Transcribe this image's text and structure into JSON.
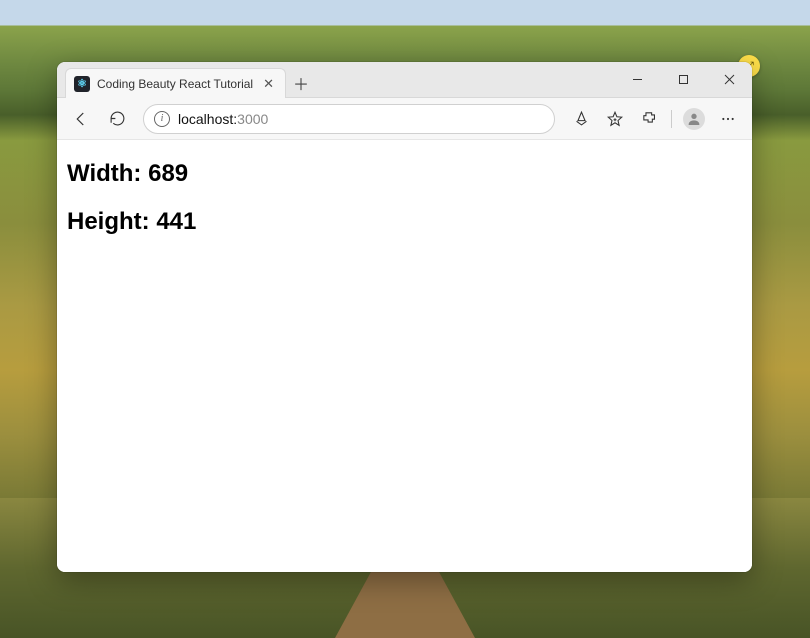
{
  "tab": {
    "title": "Coding Beauty React Tutorial"
  },
  "address": {
    "host": "localhost:",
    "port": "3000"
  },
  "page": {
    "width_label": "Width: ",
    "width_value": "689",
    "height_label": "Height: ",
    "height_value": "441"
  },
  "icons": {
    "favicon_glyph": "⚛",
    "info_glyph": "i",
    "resize_glyph": "⤢"
  }
}
